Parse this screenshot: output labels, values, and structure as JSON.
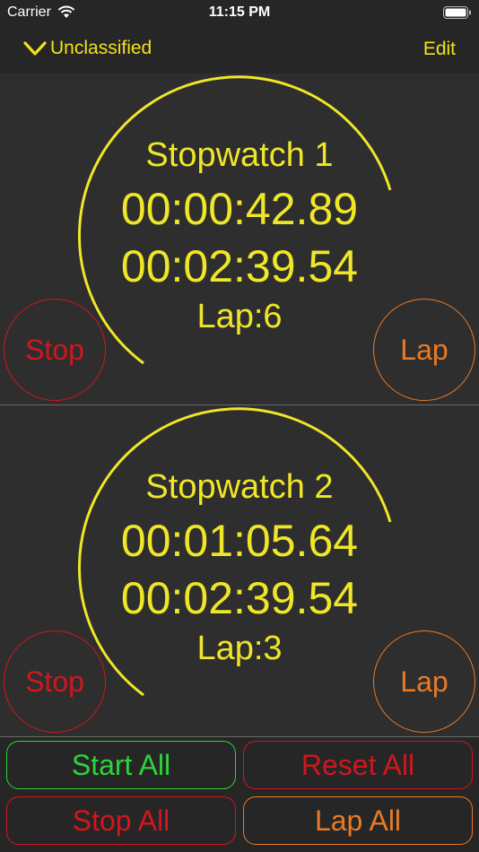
{
  "status_bar": {
    "carrier": "Carrier",
    "time": "11:15 PM"
  },
  "nav": {
    "folder_label": "Unclassified",
    "edit_label": "Edit"
  },
  "stopwatches": [
    {
      "name": "Stopwatch 1",
      "lap_time": "00:00:42.89",
      "total_time": "00:02:39.54",
      "lap_count": "Lap:6",
      "left_button": "Stop",
      "right_button": "Lap"
    },
    {
      "name": "Stopwatch 2",
      "lap_time": "00:01:05.64",
      "total_time": "00:02:39.54",
      "lap_count": "Lap:3",
      "left_button": "Stop",
      "right_button": "Lap"
    }
  ],
  "actions": {
    "start_all": "Start All",
    "reset_all": "Reset All",
    "stop_all": "Stop All",
    "lap_all": "Lap All"
  },
  "colors": {
    "accent_yellow": "#f0e628",
    "stop_red": "#d2161e",
    "lap_orange": "#ea7a25",
    "start_green": "#2ed33a"
  }
}
